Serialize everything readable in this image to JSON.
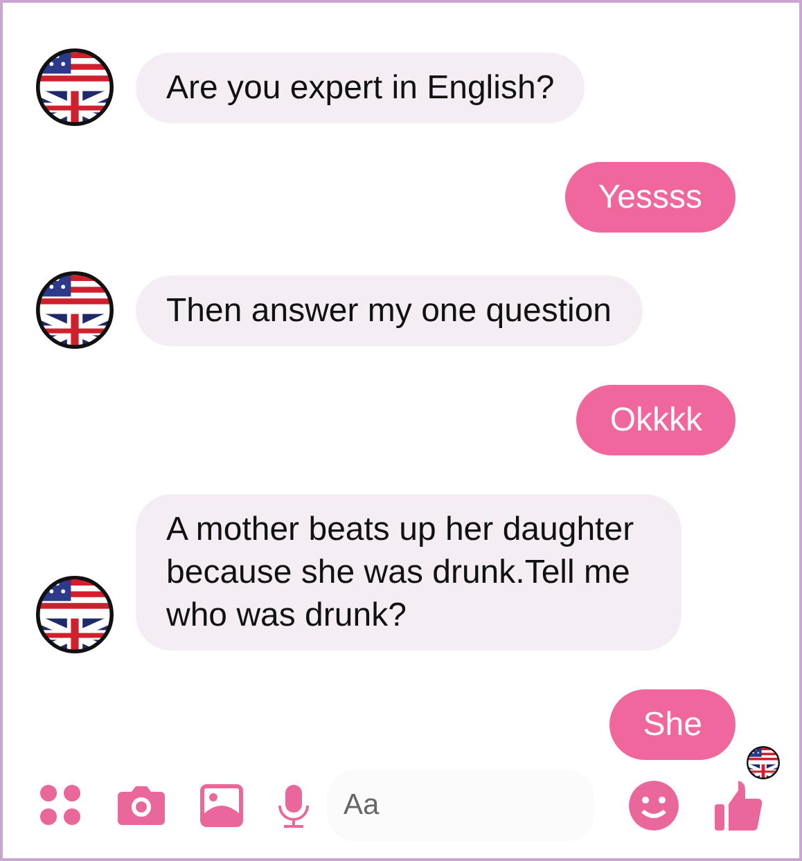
{
  "messages": [
    {
      "kind": "incoming",
      "text": "Are you expert in English?"
    },
    {
      "kind": "outgoing",
      "text": "Yessss"
    },
    {
      "kind": "incoming",
      "text": "Then answer my one question"
    },
    {
      "kind": "outgoing",
      "text": "Okkkk"
    },
    {
      "kind": "incoming",
      "text": "A mother beats up her daughter because she was drunk.Tell me who was drunk?"
    },
    {
      "kind": "outgoing",
      "text": "She"
    }
  ],
  "seen_by_recipient": true,
  "composer": {
    "placeholder": "Aa"
  }
}
